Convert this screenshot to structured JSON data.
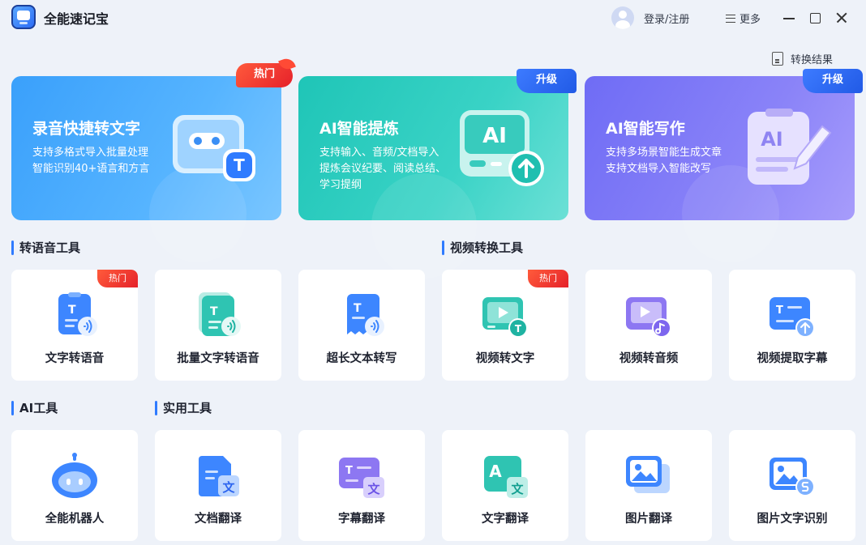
{
  "app": {
    "title": "全能速记宝"
  },
  "header": {
    "login_label": "登录/注册",
    "more_label": "更多",
    "convert_result_label": "转换结果"
  },
  "hero_cards": [
    {
      "title": "录音快捷转文字",
      "desc": [
        "支持多格式导入批量处理",
        "智能识别40+语言和方言"
      ],
      "badge": "热门"
    },
    {
      "title": "AI智能提炼",
      "desc": [
        "支持输入、音频/文档导入",
        "提炼会议纪要、阅读总结、",
        "学习提纲"
      ],
      "badge": "升级",
      "art_text": "AI"
    },
    {
      "title": "AI智能写作",
      "desc": [
        "支持多场景智能生成文章",
        "支持文档导入智能改写"
      ],
      "badge": "升级",
      "art_text": "AI"
    }
  ],
  "sections": {
    "speech": "转语音工具",
    "video": "视频转换工具",
    "ai": "AI工具",
    "utility": "实用工具"
  },
  "tools_row1": [
    {
      "label": "文字转语音",
      "badge": "热门",
      "icon": "text-to-speech-icon"
    },
    {
      "label": "批量文字转语音",
      "icon": "batch-text-to-speech-icon"
    },
    {
      "label": "超长文本转写",
      "icon": "long-text-icon"
    },
    {
      "label": "视频转文字",
      "badge": "热门",
      "icon": "video-to-text-icon"
    },
    {
      "label": "视频转音频",
      "icon": "video-to-audio-icon"
    },
    {
      "label": "视频提取字幕",
      "icon": "video-subtitle-icon"
    }
  ],
  "tools_row2": [
    {
      "label": "全能机器人",
      "icon": "robot-icon"
    },
    {
      "label": "文档翻译",
      "icon": "doc-translate-icon"
    },
    {
      "label": "字幕翻译",
      "icon": "subtitle-translate-icon"
    },
    {
      "label": "文字翻译",
      "icon": "text-translate-icon"
    },
    {
      "label": "图片翻译",
      "icon": "image-translate-icon"
    },
    {
      "label": "图片文字识别",
      "icon": "image-ocr-icon"
    }
  ],
  "glyphs": {
    "t": "T",
    "wen": "文",
    "a": "A"
  },
  "colors": {
    "accent": "#2f7bff",
    "hero_blue": "#3aa0fb",
    "hero_teal": "#1fc5b7",
    "hero_purple": "#6f6cf5",
    "hot_badge": "#e6212a",
    "upgrade_badge": "#2a63ef"
  }
}
